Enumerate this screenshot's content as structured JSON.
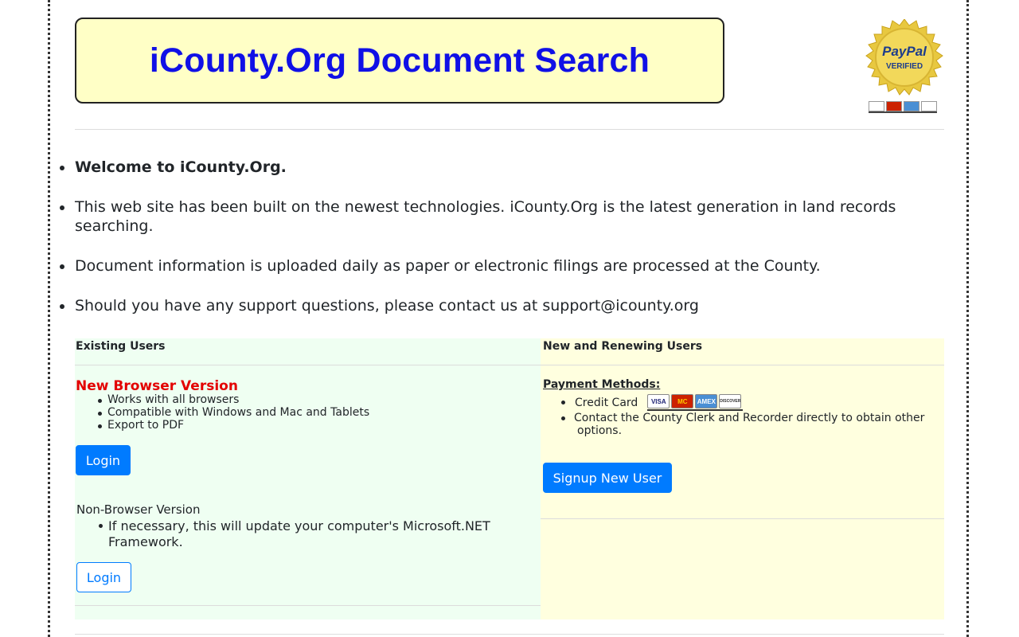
{
  "header": {
    "title": "iCounty.Org Document Search",
    "seal": {
      "line1": "PayPal",
      "line2": "VERIFIED"
    }
  },
  "intro": {
    "items": [
      "Welcome to iCounty.Org.",
      "This web site has been built on the newest technologies. iCounty.Org is the latest generation in land records searching.",
      "Document information is uploaded daily as paper or electronic filings are processed at the County.",
      "Should you have any support questions, please contact us at support@icounty.org"
    ]
  },
  "existing": {
    "heading": "Existing Users",
    "new_version": {
      "title": "New Browser Version",
      "features": [
        "Works with all browsers",
        "Compatible with Windows and Mac and Tablets",
        "Export to PDF"
      ],
      "login_label": "Login"
    },
    "non_browser": {
      "title": "Non-Browser Version",
      "features": [
        "If necessary, this will update your computer's Microsoft.NET Framework."
      ],
      "login_label": "Login"
    }
  },
  "renewing": {
    "heading": "New and Renewing Users",
    "payment_heading": "Payment Methods:",
    "methods": [
      "Credit Card",
      "Contact the County Clerk and Recorder directly to obtain other options."
    ],
    "cards": [
      "VISA",
      "MC",
      "AMEX",
      "DISCOVER"
    ],
    "signup_label": "Signup New User"
  },
  "colors": {
    "banner_bg": "#ffffc6",
    "banner_text": "#1010e6",
    "left_panel_bg": "#effff2",
    "right_panel_bg": "#ffffdf",
    "primary": "#007bff",
    "alert_red": "#e30000"
  }
}
